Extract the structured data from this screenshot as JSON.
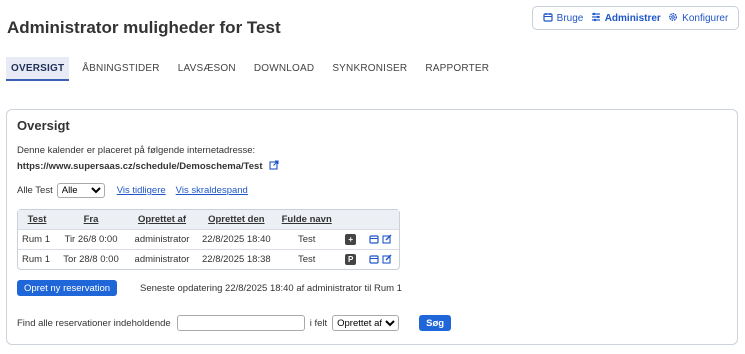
{
  "page": {
    "title": "Administrator muligheder for Test"
  },
  "top_nav": {
    "items": [
      {
        "label": "Bruge",
        "icon": "calendar-icon"
      },
      {
        "label": "Administrer",
        "icon": "sliders-icon",
        "active": true
      },
      {
        "label": "Konfigurer",
        "icon": "gear-icon"
      }
    ]
  },
  "tabs": [
    "OVERSIGT",
    "ÅBNINGSTIDER",
    "LAVSÆSON",
    "DOWNLOAD",
    "SYNKRONISER",
    "RAPPORTER"
  ],
  "overview": {
    "title": "Oversigt",
    "intro": "Denne kalender er placeret på følgende internetadresse:",
    "url": "https://www.supersaas.cz/schedule/Demoschema/Test"
  },
  "filter": {
    "label": "Alle Test",
    "select_value": "Alle",
    "link_previous": "Vis tidligere",
    "link_trash": "Vis skraldespand"
  },
  "table": {
    "headers": [
      "Test",
      "Fra",
      "Oprettet af",
      "Oprettet den",
      "Fulde navn"
    ],
    "rows": [
      {
        "test": "Rum 1",
        "fra": "Tir 26/8 0:00",
        "oprettet_af": "administrator",
        "oprettet_den": "22/8/2025 18:40",
        "fulde_navn": "Test",
        "badge": "+"
      },
      {
        "test": "Rum 1",
        "fra": "Tor 28/8 0:00",
        "oprettet_af": "administrator",
        "oprettet_den": "22/8/2025 18:38",
        "fulde_navn": "Test",
        "badge": "P"
      }
    ]
  },
  "actions": {
    "new_reservation": "Opret ny reservation",
    "last_update": "Seneste opdatering 22/8/2025 18:40 af administrator til Rum 1"
  },
  "search": {
    "label": "Find alle reservationer indeholdende",
    "input_value": "",
    "in_field_label": "i felt",
    "field_value": "Oprettet af",
    "button": "Søg"
  },
  "colors": {
    "accent": "#1f66d9",
    "link": "#1f56c9",
    "badge": "#444444"
  }
}
